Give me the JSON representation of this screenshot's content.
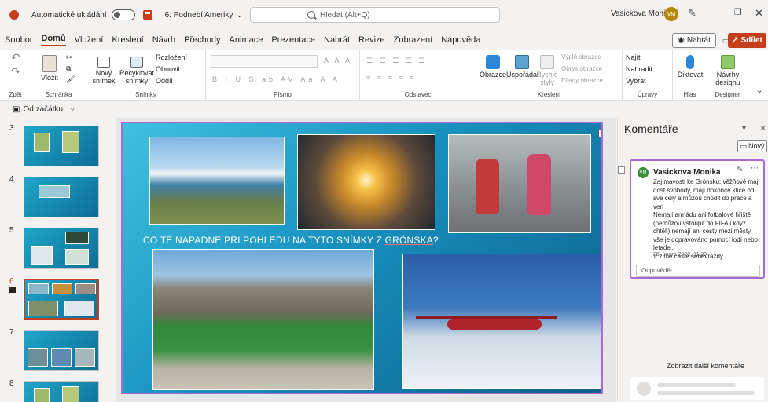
{
  "titlebar": {
    "autosave_label": "Automatické ukládání",
    "doc_title": "6. Podnebí Ameriky",
    "doc_title_caret": "⌄",
    "search_placeholder": "Hledat (Alt+Q)",
    "user_name": "Vasickova Monika",
    "user_initials": "VM"
  },
  "menu": {
    "items": [
      "Soubor",
      "Domů",
      "Vložení",
      "Kreslení",
      "Návrh",
      "Přechody",
      "Animace",
      "Prezentace",
      "Nahrát",
      "Revize",
      "Zobrazení",
      "Nápověda"
    ],
    "nahrat_btn": "Nahrát",
    "share_btn": "Sdílet"
  },
  "ribbon": {
    "zpet": "Zpět",
    "vlozit": "Vložit",
    "schranka": "Schránka",
    "novy_snimek": "Nový snímek",
    "recyklovat": "Recyklovat snímky",
    "rozlozeni": "Rozložení",
    "obnovit": "Obnovit",
    "oddil": "Oddíl",
    "snimky": "Snímky",
    "pismo": "Písmo",
    "odstavec": "Odstavec",
    "obrazce": "Obrazce",
    "usporadat": "Uspořádat",
    "rychle_styly": "Rychlé styly",
    "vypln": "Výplň obrazce",
    "obrys": "Obrys obrazce",
    "efekty": "Efekty obrazce",
    "kresleni": "Kreslení",
    "najit": "Najít",
    "nahradit": "Nahradit",
    "vybrat": "Vybrat",
    "upravy": "Úpravy",
    "diktovat": "Diktovat",
    "hlas": "Hlas",
    "navrhy": "Návrhy designu",
    "designer": "Designer"
  },
  "qab": {
    "od_zacatku": "Od začátku"
  },
  "thumbnails": [
    {
      "num": "3"
    },
    {
      "num": "4"
    },
    {
      "num": "5"
    },
    {
      "num": "6"
    },
    {
      "num": "7"
    },
    {
      "num": "8"
    }
  ],
  "slide": {
    "title_main": "CO TĚ NAPADNE PŘI POHLEDU NA TYTO SNÍMKY Z ",
    "title_underlined": "GRÓNSKA",
    "title_end": "?"
  },
  "comments": {
    "pane_title": "Komentáře",
    "new_btn": "Nový",
    "author": "Vasickova Monika",
    "author_initials": "VM",
    "text": "Zajímavosti ke Grónsku: věžňové mají dost svobody,  mají dokonce klíče od své cely a můžou chodit do práce a ven\nNemají armádu ani fotbalové hřiště (nemůžou vstoupit do FIFA i když chtěli) nemají ani cesty mezi městy, vše je dopravováno pomocí lodí nebo letadel.\nV zimě časté sebevraždy.",
    "date": "25. února 2022, 11:29",
    "reply_placeholder": "Odpovědět",
    "more_label": "Zobrazit další komentáře"
  },
  "colors": {
    "accent": "#c43e1c",
    "selection": "#a86bd6",
    "slide_bg": "#1890bf"
  }
}
